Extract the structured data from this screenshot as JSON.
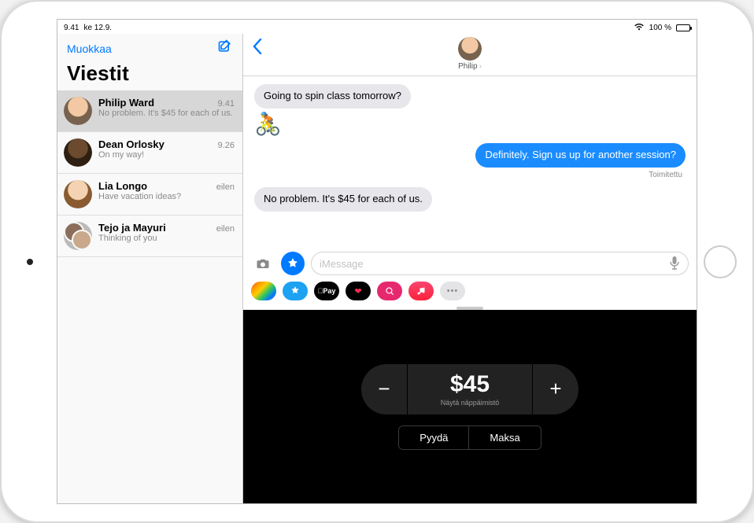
{
  "status": {
    "time": "9.41",
    "date": "ke 12.9.",
    "battery_pct": "100 %"
  },
  "sidebar": {
    "edit": "Muokkaa",
    "title": "Viestit",
    "conversations": [
      {
        "name": "Philip Ward",
        "time": "9.41",
        "preview": "No problem. It's $45 for each of us."
      },
      {
        "name": "Dean Orlosky",
        "time": "9.26",
        "preview": "On my way!"
      },
      {
        "name": "Lia Longo",
        "time": "eilen",
        "preview": "Have vacation ideas?"
      },
      {
        "name": "Tejo ja Mayuri",
        "time": "eilen",
        "preview": "Thinking of you"
      }
    ]
  },
  "chat": {
    "contact_name": "Philip",
    "messages": [
      {
        "dir": "in",
        "text": "Going to spin class tomorrow?"
      },
      {
        "dir": "emoji",
        "text": "🚴"
      },
      {
        "dir": "out",
        "text": "Definitely. Sign us up for another session?"
      },
      {
        "dir": "status",
        "text": "Toimitettu"
      },
      {
        "dir": "in",
        "text": "No problem. It's $45 for each of us."
      }
    ],
    "input_placeholder": "iMessage",
    "apps": {
      "pay_label": "Pay"
    }
  },
  "cash": {
    "amount": "$45",
    "show_kb": "Näytä näppäimistö",
    "request": "Pyydä",
    "pay": "Maksa"
  }
}
